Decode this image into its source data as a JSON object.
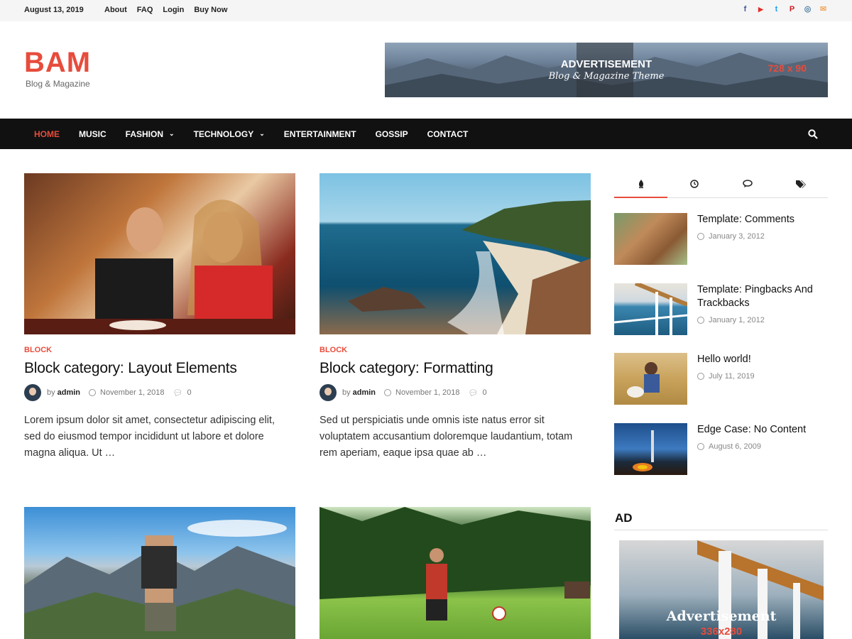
{
  "topbar": {
    "date": "August 13, 2019",
    "links": [
      "About",
      "FAQ",
      "Login",
      "Buy Now"
    ],
    "socials": [
      {
        "icon": "facebook-icon",
        "glyph": "f",
        "color": "#3b5998"
      },
      {
        "icon": "youtube-icon",
        "glyph": "▶",
        "color": "#e52d27"
      },
      {
        "icon": "twitter-icon",
        "glyph": "t",
        "color": "#1da1f2"
      },
      {
        "icon": "pinterest-icon",
        "glyph": "P",
        "color": "#cb2027"
      },
      {
        "icon": "instagram-icon",
        "glyph": "◎",
        "color": "#517fa4"
      },
      {
        "icon": "email-icon",
        "glyph": "✉",
        "color": "#f0a860"
      }
    ]
  },
  "header": {
    "logo": "BAM",
    "tagline": "Blog & Magazine",
    "banner": {
      "title": "ADVERTISEMENT",
      "subtitle": "Blog & Magazine Theme",
      "size": "728 x 90"
    }
  },
  "nav": {
    "items": [
      {
        "label": "HOME",
        "active": true,
        "dropdown": false
      },
      {
        "label": "MUSIC",
        "active": false,
        "dropdown": false
      },
      {
        "label": "FASHION",
        "active": false,
        "dropdown": true
      },
      {
        "label": "TECHNOLOGY",
        "active": false,
        "dropdown": true
      },
      {
        "label": "ENTERTAINMENT",
        "active": false,
        "dropdown": false
      },
      {
        "label": "GOSSIP",
        "active": false,
        "dropdown": false
      },
      {
        "label": "CONTACT",
        "active": false,
        "dropdown": false
      }
    ],
    "search_icon": "search-icon"
  },
  "posts": [
    {
      "category": "BLOCK",
      "title": "Block category: Layout Elements",
      "by": "by",
      "author": "admin",
      "date": "November 1, 2018",
      "comments": "0",
      "excerpt": "Lorem ipsum dolor sit amet, consectetur adipiscing elit, sed do eiusmod tempor incididunt ut labore et dolore magna aliqua. Ut …"
    },
    {
      "category": "BLOCK",
      "title": "Block category: Formatting",
      "by": "by",
      "author": "admin",
      "date": "November 1, 2018",
      "comments": "0",
      "excerpt": "Sed ut perspiciatis unde omnis iste natus error sit voluptatem accusantium doloremque laudantium, totam rem aperiam, eaque ipsa quae ab …"
    }
  ],
  "sidebar": {
    "tabs": [
      "popular-icon",
      "recent-clock-icon",
      "comments-icon",
      "tags-icon"
    ],
    "items": [
      {
        "title": "Template: Comments",
        "date": "January 3, 2012"
      },
      {
        "title": "Template: Pingbacks And Trackbacks",
        "date": "January 1, 2012"
      },
      {
        "title": "Hello world!",
        "date": "July 11, 2019"
      },
      {
        "title": "Edge Case: No Content",
        "date": "August 6, 2009"
      }
    ],
    "ad_heading": "AD",
    "ad": {
      "title": "Advertisement",
      "size": "336x280"
    }
  },
  "colors": {
    "accent": "#e74c3c",
    "nav_bg": "#111111",
    "topbar_bg": "#f5f5f5"
  }
}
